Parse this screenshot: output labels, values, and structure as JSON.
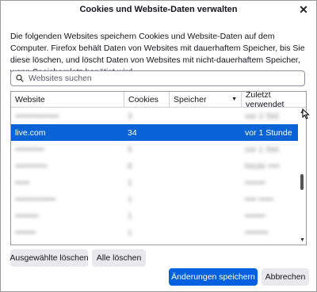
{
  "dialog": {
    "title": "Cookies und Website-Daten verwalten",
    "close_icon": "close-icon",
    "description": "Die folgenden Websites speichern Cookies und Website-Daten auf dem Computer. Firefox behält Daten von Websites mit dauerhaftem Speicher, bis Sie diese löschen, und löscht Daten von Websites mit nicht-dauerhaftem Speicher, wenn Speicherplatz benötigt wird."
  },
  "search": {
    "placeholder": "Websites suchen",
    "value": ""
  },
  "table": {
    "columns": [
      "Website",
      "Cookies",
      "Speicher",
      "Zuletzt verwendet"
    ],
    "selected_row": {
      "website": "live.com",
      "cookies": "34",
      "storage": "",
      "last_used": "vor 1 Stunde"
    },
    "rows_before": [
      {
        "website": "•••••••••••••••",
        "cookies": "3",
        "storage": "",
        "last_used": "vor 2 Std."
      }
    ],
    "rows_after": [
      {
        "website": "••••••••••",
        "cookies": "5",
        "storage": "",
        "last_used": "vor 1 Std."
      },
      {
        "website": "•••••••••••",
        "cookies": "6",
        "storage": "",
        "last_used": "heute ••••"
      },
      {
        "website": "•••••",
        "cookies": "1",
        "storage": "",
        "last_used": "•••••••"
      },
      {
        "website": "••••••••••••••",
        "cookies": "1",
        "storage": "",
        "last_used": "•••• •••••"
      },
      {
        "website": "••••••••",
        "cookies": "1",
        "storage": "",
        "last_used": "•••••••"
      },
      {
        "website": "•••••••",
        "cookies": "1",
        "storage": "",
        "last_used": "••••••••"
      }
    ]
  },
  "buttons": {
    "remove_selected": "Ausgewählte löschen",
    "remove_all": "Alle löschen",
    "save": "Änderungen speichern",
    "cancel": "Abbrechen"
  },
  "colors": {
    "selection": "#0a63d6",
    "primary_button": "#0061e0"
  }
}
